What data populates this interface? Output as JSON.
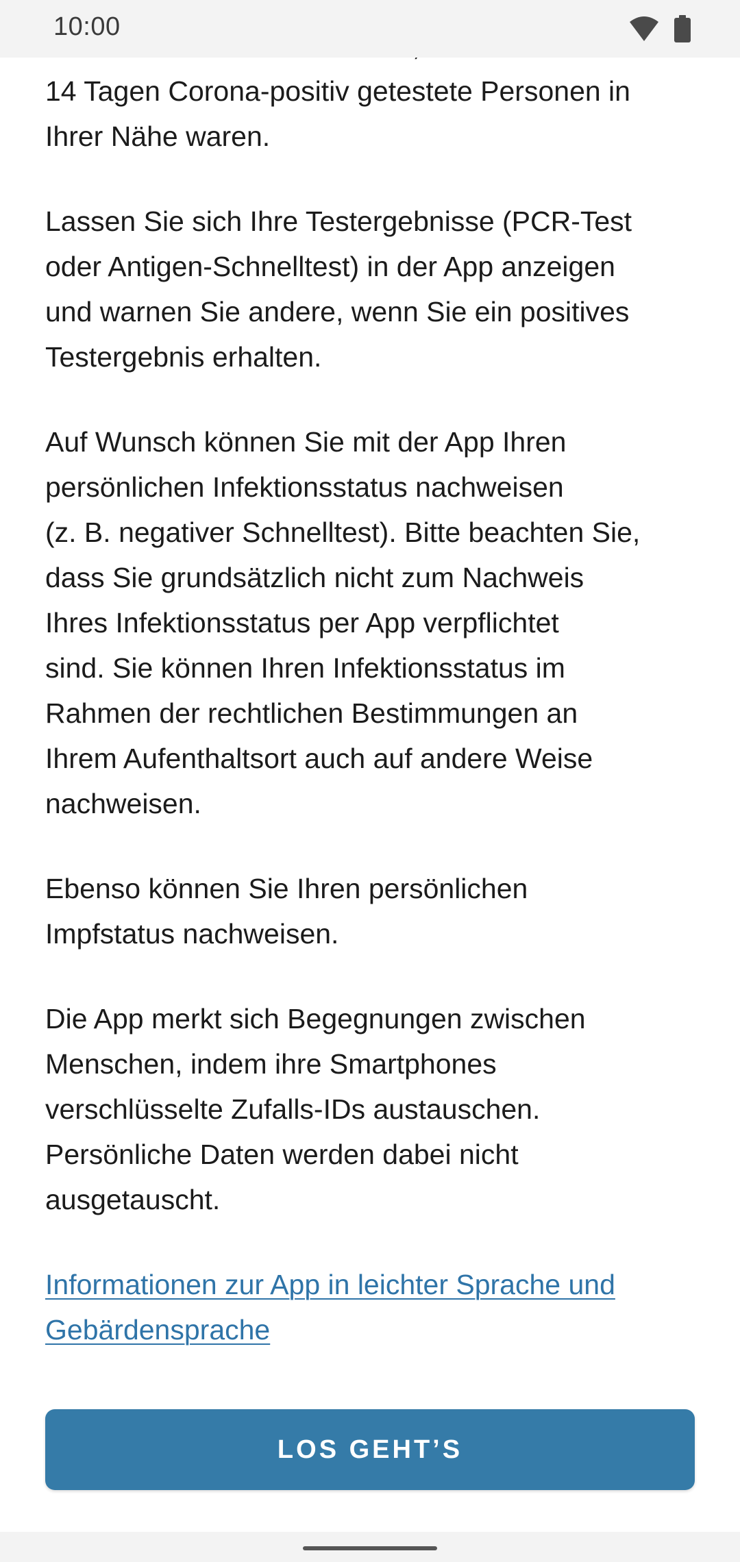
{
  "status_bar": {
    "time": "10:00",
    "icons": [
      "wifi-icon",
      "battery-icon"
    ]
  },
  "content": {
    "partial_top_line": "Risikostatus und erfahren Sie, ob in den letzten",
    "paragraphs": [
      "14 Tagen Corona-positiv getestete Personen in\nIhrer Nähe waren.",
      "Lassen Sie sich Ihre Testergebnisse (PCR-Test\noder Antigen-Schnelltest) in der App anzeigen\nund warnen Sie andere, wenn Sie ein positives\nTestergebnis erhalten.",
      "Auf Wunsch können Sie mit der App Ihren\npersönlichen Infektionsstatus nachweisen\n(z. B. negativer Schnelltest). Bitte beachten Sie,\ndass Sie grundsätzlich nicht zum Nachweis\nIhres Infektionsstatus per App verpflichtet\nsind. Sie können Ihren Infektionsstatus im\nRahmen der rechtlichen Bestimmungen an\nIhrem Aufenthaltsort auch auf andere Weise\nnachweisen.",
      "Ebenso können Sie Ihren persönlichen\nImpfstatus nachweisen.",
      "Die App merkt sich Begegnungen zwischen\nMenschen, indem ihre Smartphones\nverschlüsselte Zufalls-IDs austauschen.\nPersönliche Daten werden dabei nicht\nausgetauscht."
    ],
    "info_link": "Informationen zur App in leichter Sprache und\nGebärdensprache"
  },
  "button": {
    "label": "LOS GEHT’S"
  },
  "colors": {
    "accent": "#357ba8",
    "link": "#2f74a8",
    "text": "#1b1b1b",
    "status_bar_bg": "#f3f3f3"
  }
}
